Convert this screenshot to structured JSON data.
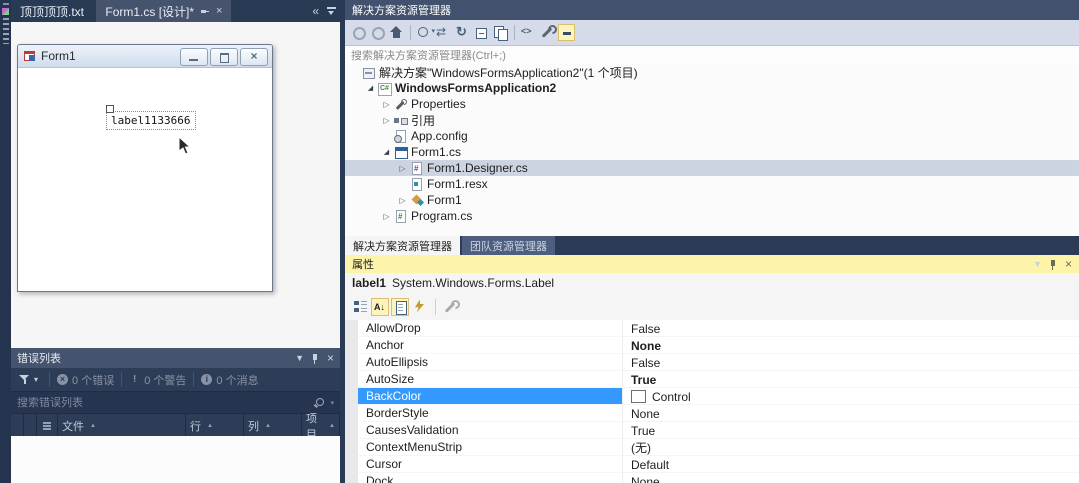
{
  "doc_tabs": {
    "tab1_label": "顶顶顶顶.txt",
    "tab2_label": "Form1.cs [设计]*",
    "overflow_chevron": "«"
  },
  "designer": {
    "form_title": "Form1",
    "label_text": "label1133666"
  },
  "solution_explorer": {
    "title": "解决方案资源管理器",
    "search_placeholder": "搜索解决方案资源管理器(Ctrl+;)",
    "toolbar_icons": [
      "back-icon",
      "forward-icon",
      "home-icon",
      "sep",
      "scope-icon",
      "sync-icon",
      "refresh-icon",
      "collapse-all-icon",
      "show-all-files-icon",
      "sep",
      "view-code-icon",
      "wrench-icon",
      "preview-selected-icon"
    ],
    "tree": [
      {
        "id": "solution",
        "label": "解决方案\"WindowsFormsApplication2\"(1 个项目)",
        "icon": "solution-icon",
        "indent": 0,
        "arrow": "none",
        "bold": false,
        "selected": false
      },
      {
        "id": "project",
        "label": "WindowsFormsApplication2",
        "icon": "csproj-icon",
        "indent": 1,
        "arrow": "expanded",
        "bold": true,
        "selected": false
      },
      {
        "id": "properties",
        "label": "Properties",
        "icon": "properties-wrench-icon",
        "indent": 2,
        "arrow": "collapsed",
        "bold": false,
        "selected": false
      },
      {
        "id": "references",
        "label": "引用",
        "icon": "references-icon",
        "indent": 2,
        "arrow": "collapsed",
        "bold": false,
        "selected": false
      },
      {
        "id": "app-config",
        "label": "App.config",
        "icon": "config-icon",
        "indent": 2,
        "arrow": "none",
        "bold": false,
        "selected": false
      },
      {
        "id": "form1-cs",
        "label": "Form1.cs",
        "icon": "form-tree-icon",
        "indent": 2,
        "arrow": "expanded",
        "bold": false,
        "selected": false
      },
      {
        "id": "form1-designer-cs",
        "label": "Form1.Designer.cs",
        "icon": "cs-file-icon",
        "indent": 3,
        "arrow": "collapsed",
        "bold": false,
        "selected": true
      },
      {
        "id": "form1-resx",
        "label": "Form1.resx",
        "icon": "resx-file-icon",
        "indent": 3,
        "arrow": "none",
        "bold": false,
        "selected": false
      },
      {
        "id": "form1-class",
        "label": "Form1",
        "icon": "class-icon",
        "indent": 3,
        "arrow": "collapsed",
        "bold": false,
        "selected": false
      },
      {
        "id": "program-cs",
        "label": "Program.cs",
        "icon": "csharp-file-icon",
        "indent": 2,
        "arrow": "collapsed",
        "bold": false,
        "selected": false
      }
    ]
  },
  "panel_tabs": {
    "active": "解决方案资源管理器",
    "inactive": "团队资源管理器"
  },
  "properties_panel": {
    "title": "属性",
    "object_name": "label1",
    "object_type": "System.Windows.Forms.Label",
    "toolbar_icons": [
      "categorized-icon",
      "alphabetical-icon:hl",
      "properties-sheet-icon:hl",
      "events-icon",
      "sep",
      "property-pages-icon"
    ],
    "rows": [
      {
        "name": "AllowDrop",
        "value": "False",
        "bold": false,
        "selected": false,
        "swatch": false
      },
      {
        "name": "Anchor",
        "value": "None",
        "bold": true,
        "selected": false,
        "swatch": false
      },
      {
        "name": "AutoEllipsis",
        "value": "False",
        "bold": false,
        "selected": false,
        "swatch": false
      },
      {
        "name": "AutoSize",
        "value": "True",
        "bold": true,
        "selected": false,
        "swatch": false
      },
      {
        "name": "BackColor",
        "value": "Control",
        "bold": false,
        "selected": true,
        "swatch": true
      },
      {
        "name": "BorderStyle",
        "value": "None",
        "bold": false,
        "selected": false,
        "swatch": false
      },
      {
        "name": "CausesValidation",
        "value": "True",
        "bold": false,
        "selected": false,
        "swatch": false
      },
      {
        "name": "ContextMenuStrip",
        "value": "(无)",
        "bold": false,
        "selected": false,
        "swatch": false
      },
      {
        "name": "Cursor",
        "value": "Default",
        "bold": false,
        "selected": false,
        "swatch": false
      },
      {
        "name": "Dock",
        "value": "None",
        "bold": false,
        "selected": false,
        "swatch": false
      }
    ]
  },
  "error_list": {
    "title": "错误列表",
    "errors": "0 个错误",
    "warnings": "0 个警告",
    "messages": "0 个消息",
    "search_placeholder": "搜索错误列表",
    "columns": [
      "文件",
      "行",
      "列",
      "项目"
    ]
  },
  "colors": {
    "chrome_navy": "#293a55",
    "panel_title": "#42516d",
    "focused_title_yellow": "#fdf4a9",
    "selection_blue": "#3399ff",
    "selected_row_gray": "#ccd3e1"
  }
}
